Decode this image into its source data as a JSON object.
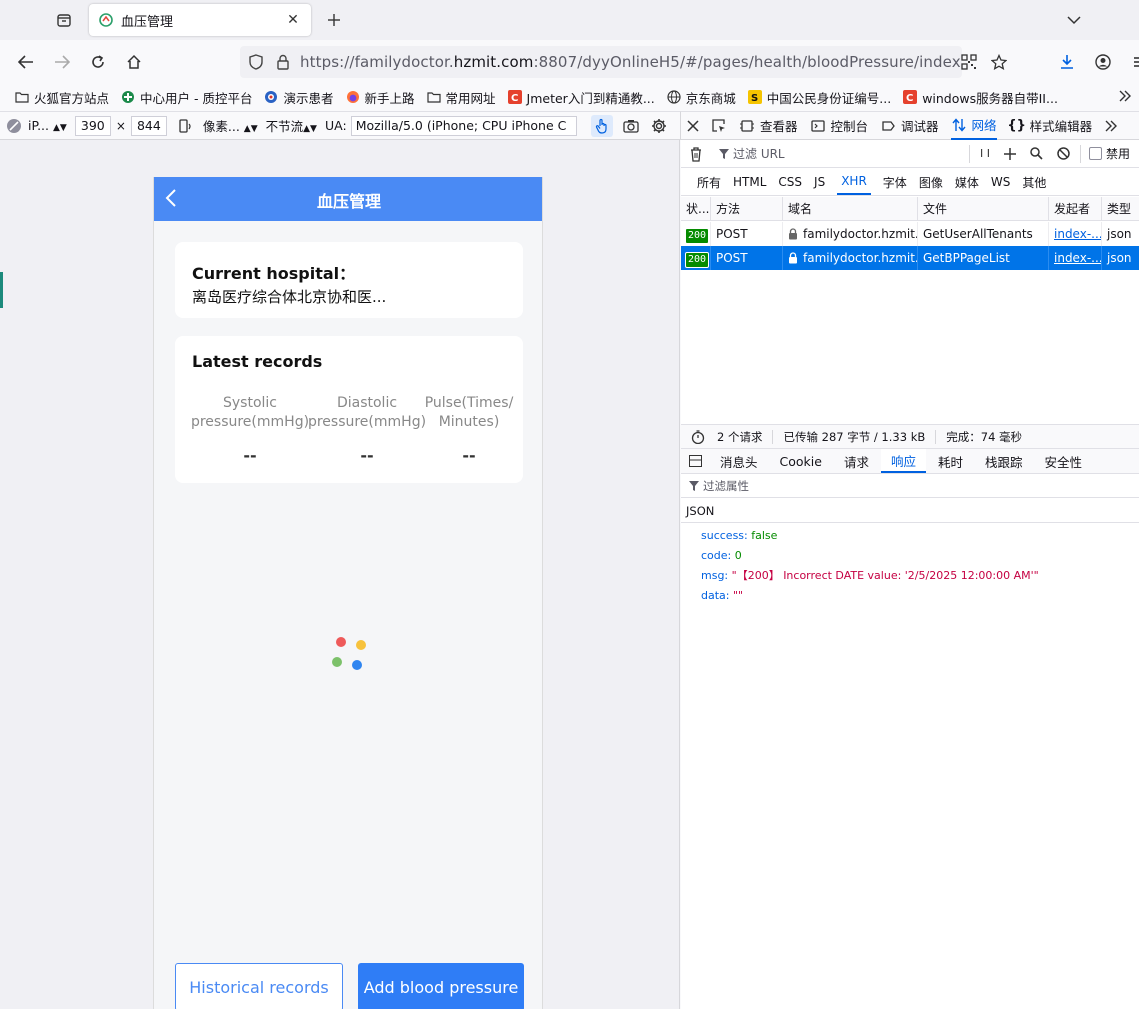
{
  "browser": {
    "tab_title": "血压管理",
    "url": {
      "prefix": "https://familydoctor.",
      "host": "hzmit.com",
      "suffix": ":8807/dyyOnlineH5/#/pages/health/bloodPressure/index"
    },
    "bookmarks": [
      "火狐官方站点",
      "中心用户 - 质控平台",
      "演示患者",
      "新手上路",
      "常用网址",
      "Jmeter入门到精通教...",
      "京东商城",
      "中国公民身份证编号...",
      "windows服务器自带II..."
    ]
  },
  "rdm": {
    "device": "iP...",
    "width": "390",
    "times": "×",
    "height": "844",
    "dpr": "像素...",
    "throttle": "不节流",
    "ua_label": "UA:",
    "ua_value": "Mozilla/5.0 (iPhone; CPU iPhone C"
  },
  "devtools": {
    "tabs": [
      "查看器",
      "控制台",
      "调试器",
      "网络",
      "样式编辑器"
    ],
    "active_tab": "网络",
    "filter_placeholder": "过滤 URL",
    "pause_label": "I I",
    "disable_label": "禁用",
    "types": [
      "所有",
      "HTML",
      "CSS",
      "JS",
      "XHR",
      "字体",
      "图像",
      "媒体",
      "WS",
      "其他"
    ],
    "active_type": "XHR",
    "columns": [
      "状...",
      "方法",
      "域名",
      "文件",
      "发起者",
      "类型"
    ],
    "requests": [
      {
        "status": "200",
        "method": "POST",
        "domain": "familydoctor.hzmit....",
        "file": "GetUserAllTenants",
        "initiator": "index-...",
        "type": "json"
      },
      {
        "status": "200",
        "method": "POST",
        "domain": "familydoctor.hzmit....",
        "file": "GetBPPageList",
        "initiator": "index-...",
        "type": "json"
      }
    ],
    "summary": {
      "requests": "2 个请求",
      "transferred": "已传输 287 字节 / 1.33 kB",
      "finish": "完成：74 毫秒"
    },
    "detail_tabs": [
      "消息头",
      "Cookie",
      "请求",
      "响应",
      "耗时",
      "栈跟踪",
      "安全性"
    ],
    "active_detail": "响应",
    "prop_filter": "过滤属性",
    "json_label": "JSON",
    "json": [
      {
        "key": "success:",
        "value": "false",
        "kind": "bool"
      },
      {
        "key": "code:",
        "value": "0",
        "kind": "bool"
      },
      {
        "key": "msg:",
        "value": "\"【200】 Incorrect DATE value: '2/5/2025 12:00:00 AM'\"",
        "kind": "str"
      },
      {
        "key": "data:",
        "value": "\"\"",
        "kind": "str"
      }
    ]
  },
  "app": {
    "title": "血压管理",
    "hospital_label": "Current hospital：",
    "hospital_name": "离岛医疗综合体北京协和医...",
    "records_title": "Latest records",
    "columns": [
      {
        "line1": "Systolic",
        "line2": "pressure(mmHg)",
        "value": "--"
      },
      {
        "line1": "Diastolic",
        "line2": "pressure(mmHg)",
        "value": "--"
      },
      {
        "line1": "Pulse(Times/",
        "line2": "Minutes)",
        "value": "--"
      }
    ],
    "btn_history": "Historical records",
    "btn_add": "Add blood pressure",
    "accent": "#4a8af4"
  }
}
